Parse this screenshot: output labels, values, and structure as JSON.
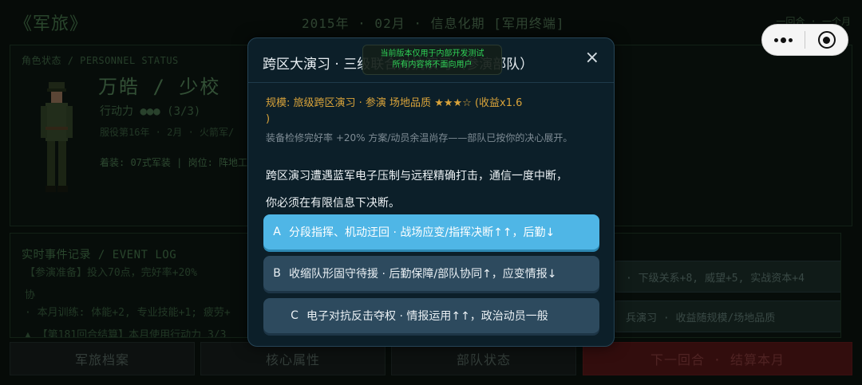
{
  "app": {
    "title": "《军旅》",
    "date_line": "2015年 · 02月 · 信息化期 [军用终端]",
    "round_info": "一回合 · 一个月"
  },
  "personnel": {
    "label": "角色状态 / PERSONNEL STATUS",
    "name": "万皓",
    "rank": "少校",
    "action_points_label": "行动力",
    "action_points_value": "(3/3)",
    "service_line": "服役第16年 · 2月 · 火箭军/",
    "equip_line": "着装: 07式军装 | 岗位: 阵地工"
  },
  "event_log": {
    "title": "实时事件记录 / EVENT LOG",
    "lines": [
      "【参演准备】投入70点，完好率+20%",
      "协",
      "· 本月训练: 体能+2, 专业技能+1; 疲劳+",
      "▲ 【第181回合结算】本月使用行动力 3/3"
    ],
    "side_cards": [
      "· 下级关系+8, 威望+5, 实战资本+4",
      "兵演习 · 收益随规模/场地品质"
    ]
  },
  "bottom_nav": {
    "archive": "军旅档案",
    "attributes": "核心属性",
    "unit_status": "部队状态",
    "next_round": "下一回合 · 结算本月"
  },
  "modal": {
    "title": "跨区大演习 · 三级联合对抗演习（参演部队）",
    "close_glyph": "×",
    "debug_line1": "当前版本仅用于内部开发测试",
    "debug_line2": "所有内容将不面向用户",
    "meta_prefix": "规模: 旅级跨区演习 · 参演 场地品质",
    "meta_stars": "★★★☆",
    "meta_suffix": "(收益x1.6",
    "meta_close": ")",
    "note": "装备检修完好率 +20% 方案/动员余温尚存——部队已按你的决心展开。",
    "desc1": "跨区演习遭遇蓝军电子压制与远程精确打击，通信一度中断，",
    "desc2": "你必须在有限信息下决断。",
    "options": [
      {
        "key": "A",
        "text": "分段指挥、机动迂回 · 战场应变/指挥决断↑↑，后勤↓"
      },
      {
        "key": "B",
        "text": "收缩队形固守待援 · 后勤保障/部队协同↑，应变情报↓"
      },
      {
        "key": "C",
        "text": "电子对抗反击夺权 · 情报运用↑↑，政治动员一般"
      }
    ]
  },
  "capsule": {
    "menu_icon": "more-dots-icon",
    "close_icon": "record-close-icon"
  }
}
